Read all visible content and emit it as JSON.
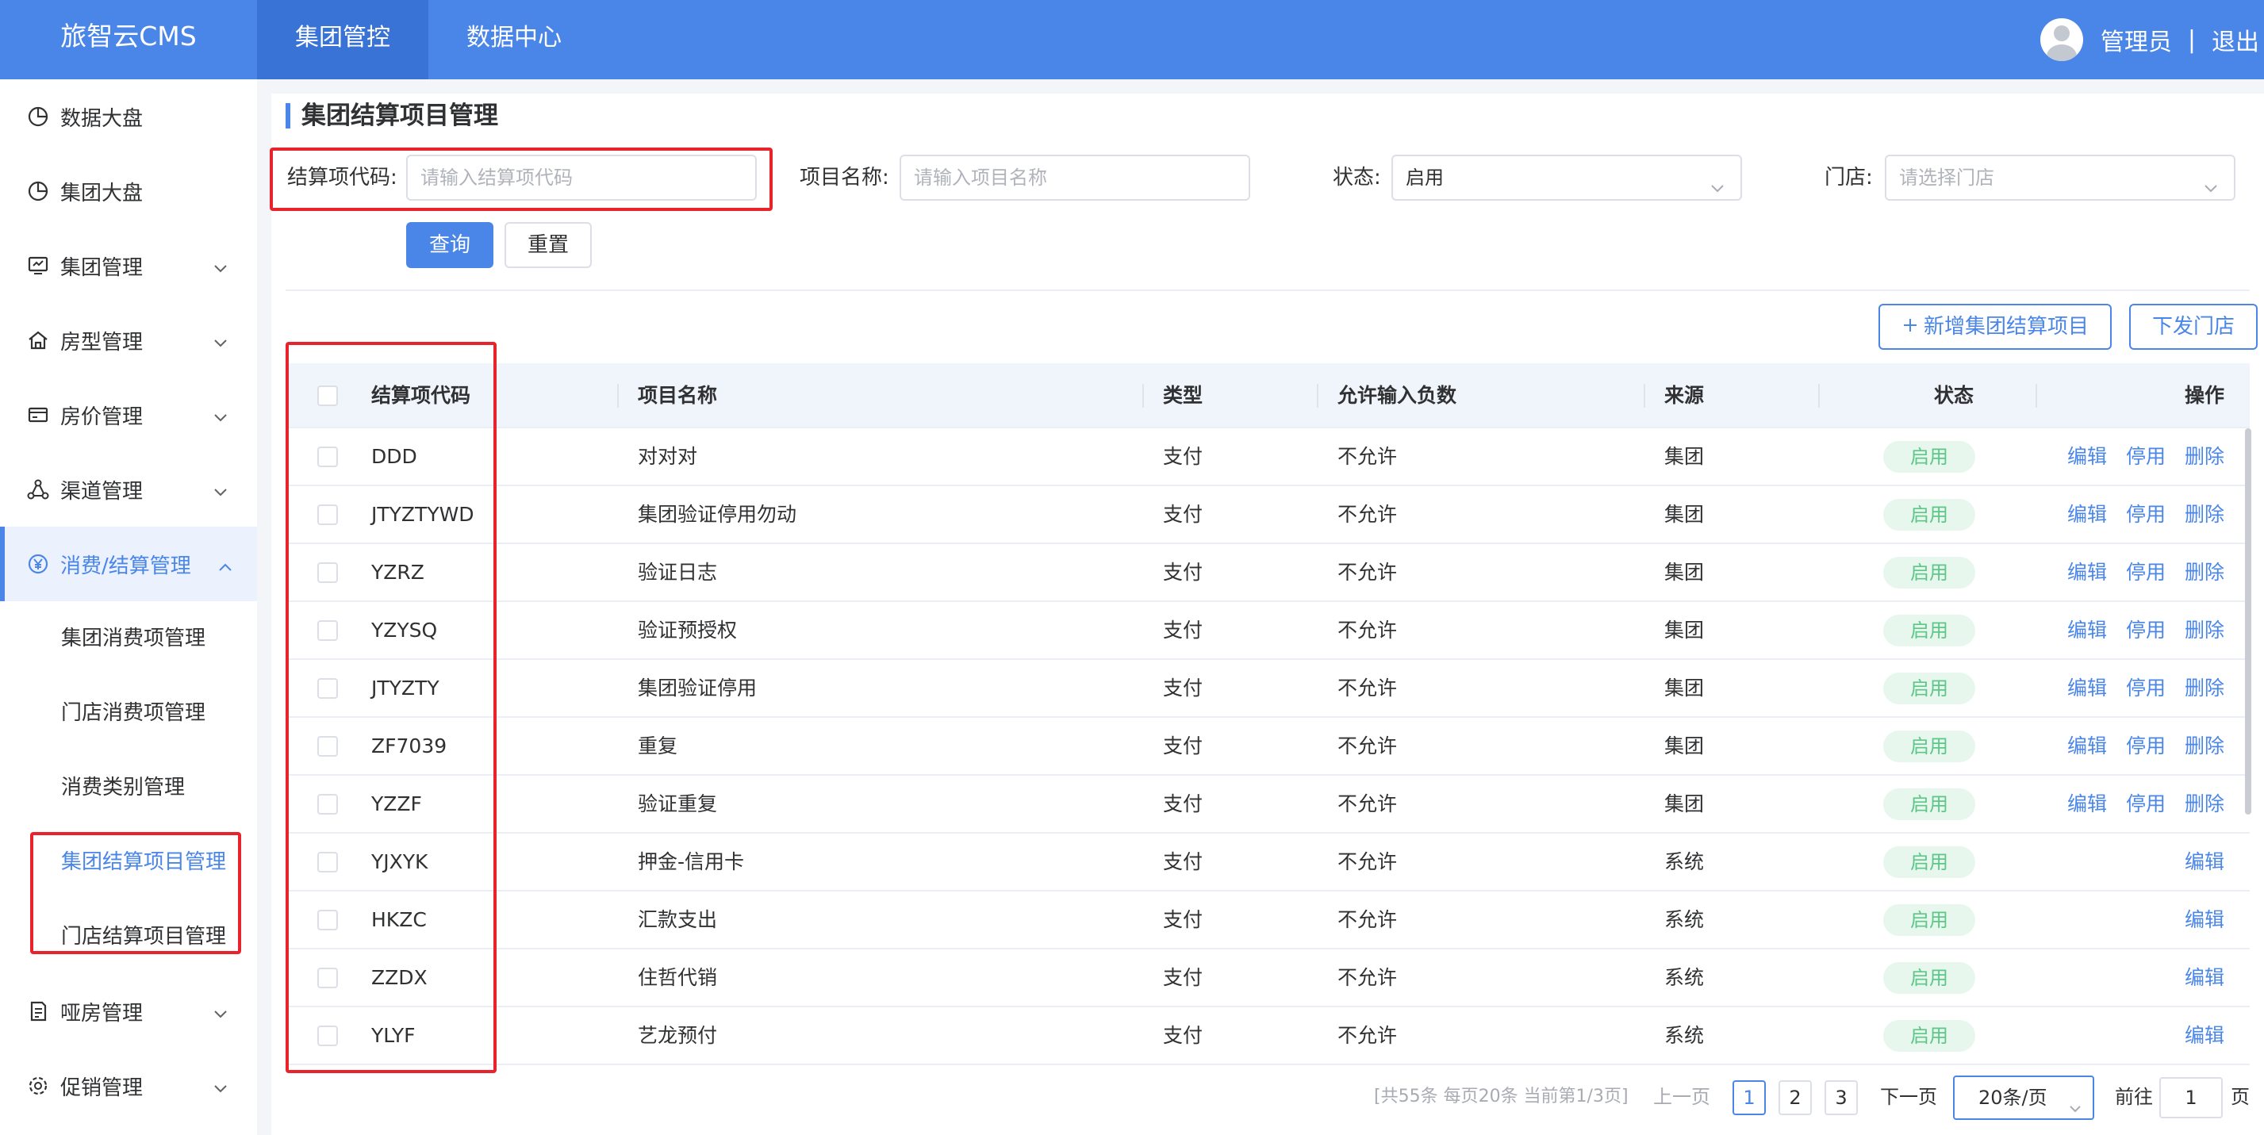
{
  "app": {
    "logo": "旅智云CMS"
  },
  "topnav": [
    {
      "label": "集团管控",
      "active": true
    },
    {
      "label": "数据中心",
      "active": false
    }
  ],
  "user": {
    "name": "管理员",
    "separator": "|",
    "logout": "退出"
  },
  "sidebar": {
    "items": [
      {
        "label": "数据大盘",
        "icon": "pie-chart-icon"
      },
      {
        "label": "集团大盘",
        "icon": "pie-chart-icon"
      },
      {
        "label": "集团管理",
        "icon": "monitor-icon"
      },
      {
        "label": "房型管理",
        "icon": "home-icon"
      },
      {
        "label": "房价管理",
        "icon": "card-icon"
      },
      {
        "label": "渠道管理",
        "icon": "network-icon"
      },
      {
        "label": "消费/结算管理",
        "icon": "yen-icon"
      },
      {
        "label": "哑房管理",
        "icon": "document-icon"
      },
      {
        "label": "促销管理",
        "icon": "gear-icon"
      }
    ],
    "subitems": [
      {
        "label": "集团消费项管理"
      },
      {
        "label": "门店消费项管理"
      },
      {
        "label": "消费类别管理"
      },
      {
        "label": "集团结算项目管理"
      },
      {
        "label": "门店结算项目管理"
      }
    ]
  },
  "page": {
    "title": "集团结算项目管理"
  },
  "filters": {
    "code_label": "结算项代码:",
    "code_placeholder": "请输入结算项代码",
    "name_label": "项目名称:",
    "name_placeholder": "请输入项目名称",
    "status_label": "状态:",
    "status_value": "启用",
    "store_label": "门店:",
    "store_placeholder": "请选择门店",
    "query": "查询",
    "reset": "重置"
  },
  "actions": {
    "add": "新增集团结算项目",
    "dispatch": "下发门店"
  },
  "table": {
    "headers": {
      "code": "结算项代码",
      "name": "项目名称",
      "type": "类型",
      "negative": "允许输入负数",
      "source": "来源",
      "status": "状态",
      "ops": "操作"
    },
    "rows": [
      {
        "code": "DDD",
        "name": "对对对",
        "type": "支付",
        "negative": "不允许",
        "source": "集团",
        "status": "启用",
        "ops": [
          "编辑",
          "停用",
          "删除"
        ]
      },
      {
        "code": "JTYZTYWD",
        "name": "集团验证停用勿动",
        "type": "支付",
        "negative": "不允许",
        "source": "集团",
        "status": "启用",
        "ops": [
          "编辑",
          "停用",
          "删除"
        ]
      },
      {
        "code": "YZRZ",
        "name": "验证日志",
        "type": "支付",
        "negative": "不允许",
        "source": "集团",
        "status": "启用",
        "ops": [
          "编辑",
          "停用",
          "删除"
        ]
      },
      {
        "code": "YZYSQ",
        "name": "验证预授权",
        "type": "支付",
        "negative": "不允许",
        "source": "集团",
        "status": "启用",
        "ops": [
          "编辑",
          "停用",
          "删除"
        ]
      },
      {
        "code": "JTYZTY",
        "name": "集团验证停用",
        "type": "支付",
        "negative": "不允许",
        "source": "集团",
        "status": "启用",
        "ops": [
          "编辑",
          "停用",
          "删除"
        ]
      },
      {
        "code": "ZF7039",
        "name": "重复",
        "type": "支付",
        "negative": "不允许",
        "source": "集团",
        "status": "启用",
        "ops": [
          "编辑",
          "停用",
          "删除"
        ]
      },
      {
        "code": "YZZF",
        "name": "验证重复",
        "type": "支付",
        "negative": "不允许",
        "source": "集团",
        "status": "启用",
        "ops": [
          "编辑",
          "停用",
          "删除"
        ]
      },
      {
        "code": "YJXYK",
        "name": "押金-信用卡",
        "type": "支付",
        "negative": "不允许",
        "source": "系统",
        "status": "启用",
        "ops": [
          "编辑"
        ]
      },
      {
        "code": "HKZC",
        "name": "汇款支出",
        "type": "支付",
        "negative": "不允许",
        "source": "系统",
        "status": "启用",
        "ops": [
          "编辑"
        ]
      },
      {
        "code": "ZZDX",
        "name": "住哲代销",
        "type": "支付",
        "negative": "不允许",
        "source": "系统",
        "status": "启用",
        "ops": [
          "编辑"
        ]
      },
      {
        "code": "YLYF",
        "name": "艺龙预付",
        "type": "支付",
        "negative": "不允许",
        "source": "系统",
        "status": "启用",
        "ops": [
          "编辑"
        ]
      }
    ]
  },
  "pagination": {
    "summary": "[共55条 每页20条 当前第1/3页]",
    "prev": "上一页",
    "pages": [
      "1",
      "2",
      "3"
    ],
    "current": "1",
    "next": "下一页",
    "page_size": "20条/页",
    "goto_prefix": "前往",
    "goto_value": "1",
    "goto_suffix": "页"
  },
  "colors": {
    "primary": "#4a86e8",
    "highlight": "#e8232b",
    "status_bg": "#e7f7ed",
    "status_text": "#5cc788"
  }
}
